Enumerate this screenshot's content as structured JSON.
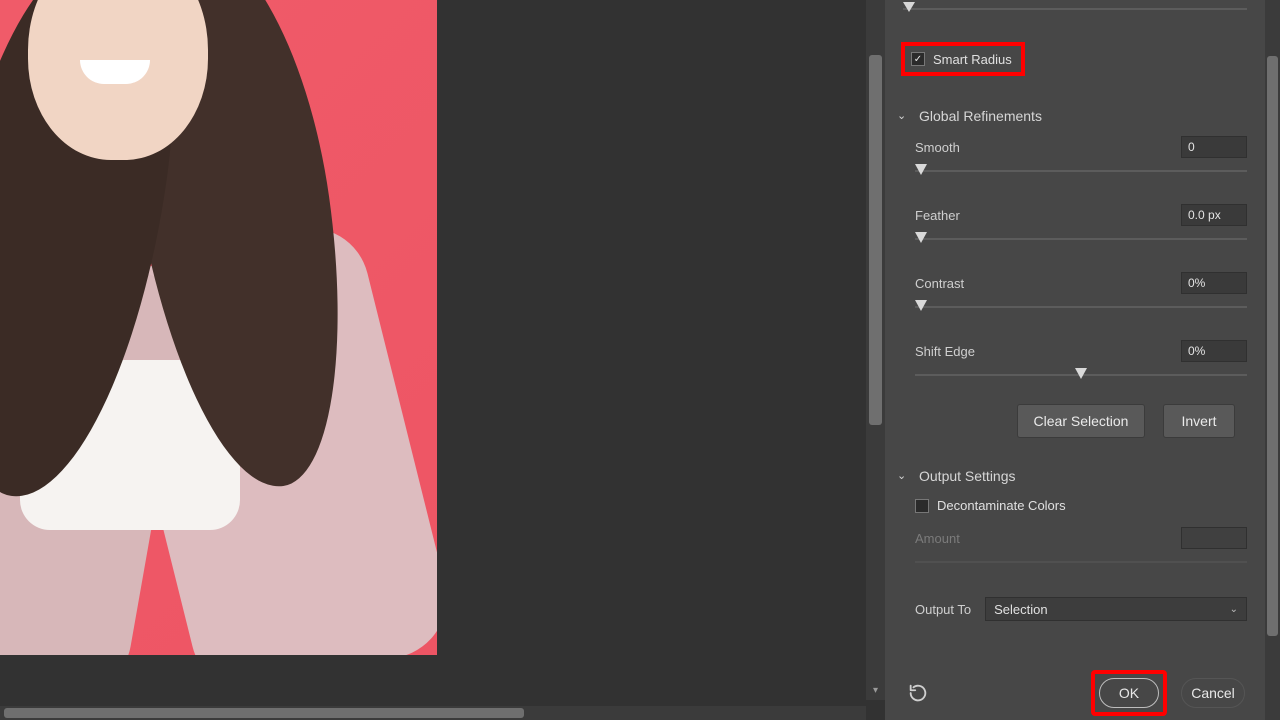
{
  "smart_radius": {
    "label": "Smart Radius",
    "checked": true
  },
  "global_refinements": {
    "title": "Global Refinements",
    "smooth": {
      "label": "Smooth",
      "value": "0",
      "pos": 0
    },
    "feather": {
      "label": "Feather",
      "value": "0.0 px",
      "pos": 0
    },
    "contrast": {
      "label": "Contrast",
      "value": "0%",
      "pos": 0
    },
    "shift_edge": {
      "label": "Shift Edge",
      "value": "0%",
      "pos": 50
    },
    "clear_btn": "Clear Selection",
    "invert_btn": "Invert"
  },
  "output_settings": {
    "title": "Output Settings",
    "decontaminate": {
      "label": "Decontaminate Colors",
      "checked": false
    },
    "amount": {
      "label": "Amount",
      "value": ""
    },
    "output_to": {
      "label": "Output To",
      "value": "Selection"
    }
  },
  "footer": {
    "ok": "OK",
    "cancel": "Cancel"
  }
}
